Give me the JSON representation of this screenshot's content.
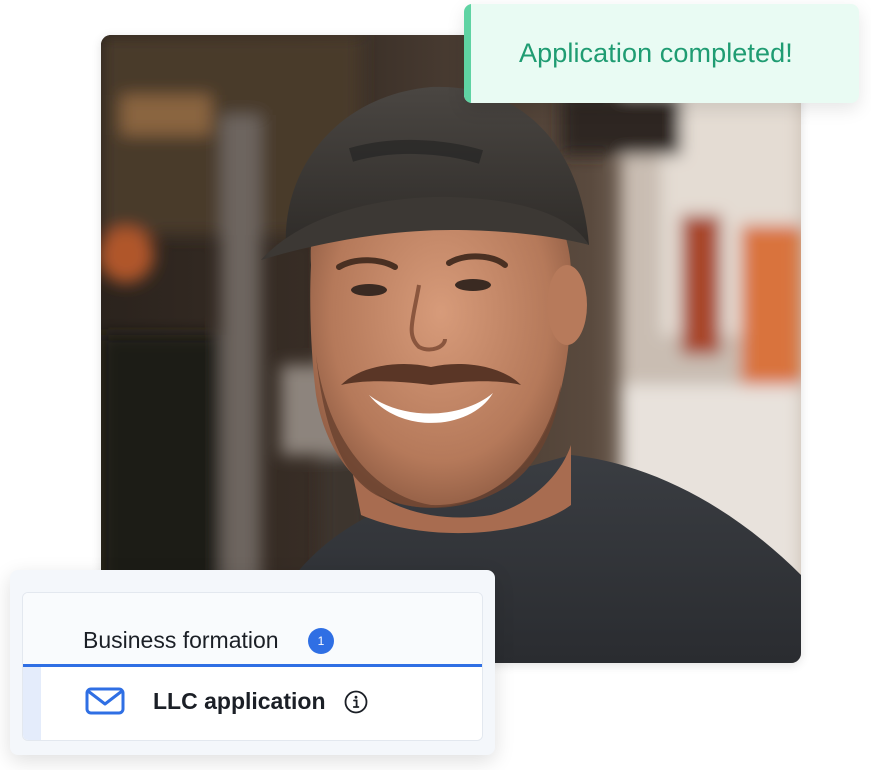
{
  "toast": {
    "message": "Application completed!",
    "colors": {
      "background": "#e9fbf3",
      "accent": "#5fd3a3",
      "text": "#1f9c72"
    }
  },
  "photo": {
    "alt": "Smiling man wearing a gray baseball cap"
  },
  "card": {
    "tab": {
      "label": "Business formation",
      "badge_count": "1"
    },
    "item": {
      "icon": "mail-icon",
      "label": "LLC application",
      "info_icon": "info-icon"
    },
    "colors": {
      "accent": "#2f6fe4",
      "row_indicator": "#e4ecfb"
    }
  }
}
